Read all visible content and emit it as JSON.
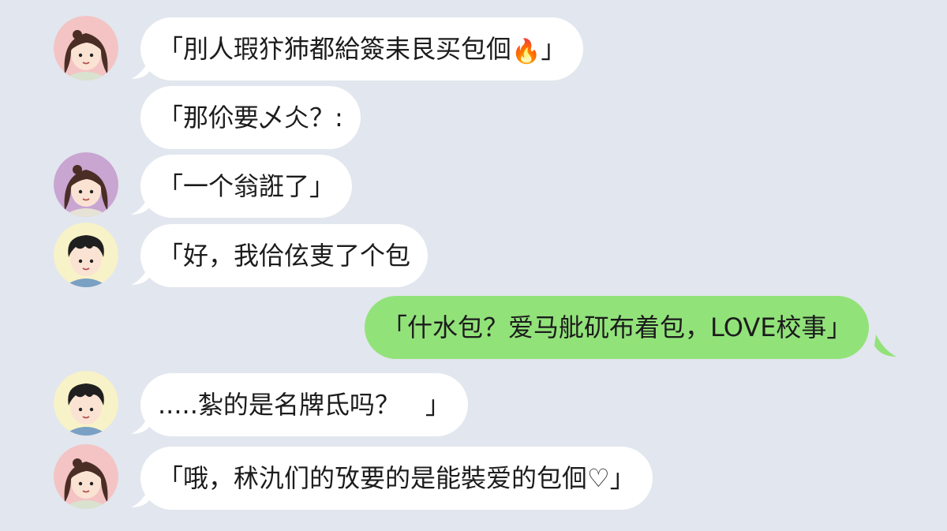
{
  "messages": [
    {
      "side": "left",
      "avatar": "girl-avatar",
      "text": "「刖人瑕犿犻都給簽耒艮买包佪",
      "emoji": "🔥",
      "suffix": "」"
    },
    {
      "side": "left",
      "avatar": "",
      "text": "「那伱要乄仌？:"
    },
    {
      "side": "left",
      "avatar": "girl-avatar-purple",
      "text": "「一个翁誑了」"
    },
    {
      "side": "left",
      "avatar": "boy-avatar",
      "text": "「好，我佮伭叓了个包"
    },
    {
      "side": "right",
      "avatar": "",
      "text": "「什水包？爱马舭矹布着包，LOVE校事」"
    },
    {
      "side": "left",
      "avatar": "boy-avatar",
      "text": ".....紮的是名牌氐吗？　」"
    },
    {
      "side": "left",
      "avatar": "girl-avatar",
      "text": "「哦，秫氿们的攷要的是能裝爱的包佪♡」"
    }
  ],
  "colors": {
    "background": "#e2e6ee",
    "incoming_bubble": "#ffffff",
    "outgoing_bubble": "#92e27a",
    "avatar_pink": "#f4c3c4",
    "avatar_purple": "#c9a5d2",
    "avatar_yellow": "#f8f2c8"
  }
}
